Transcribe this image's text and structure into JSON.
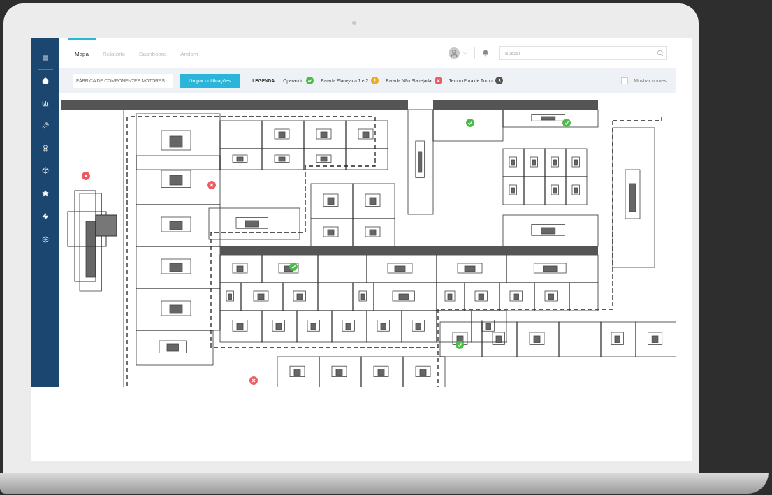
{
  "tabs": [
    {
      "label": "Mapa",
      "selected": true
    },
    {
      "label": "Relatório",
      "selected": false
    },
    {
      "label": "Dashboard",
      "selected": false
    },
    {
      "label": "Andom",
      "selected": false
    }
  ],
  "search": {
    "placeholder": "Buscar"
  },
  "toolbar": {
    "factory": "FÁBRICA DE COMPONENTES MOTORES",
    "clear_button": "Limpar notificações",
    "legend_title": "LEGENDA:",
    "legend": [
      {
        "label": "Operando",
        "kind": "operating"
      },
      {
        "label": "Parada Planejada 1 e 2",
        "kind": "planned"
      },
      {
        "label": "Parada Não Planejada",
        "kind": "unplanned"
      },
      {
        "label": "Tempo Fora de Turno",
        "kind": "off_shift"
      }
    ],
    "show_names": {
      "label": "Mostrar nomes",
      "checked": false
    }
  },
  "machines": [
    {
      "kind": "unplanned",
      "color": "#ee5a5f"
    },
    {
      "kind": "unplanned",
      "color": "#ee5a5f"
    },
    {
      "kind": "operating",
      "color": "#4cbb4a"
    },
    {
      "kind": "operating",
      "color": "#4cbb4a"
    },
    {
      "kind": "operating",
      "color": "#4cbb4a"
    },
    {
      "kind": "operating",
      "color": "#4cbb4a"
    },
    {
      "kind": "unplanned",
      "color": "#ee5a5f"
    }
  ]
}
